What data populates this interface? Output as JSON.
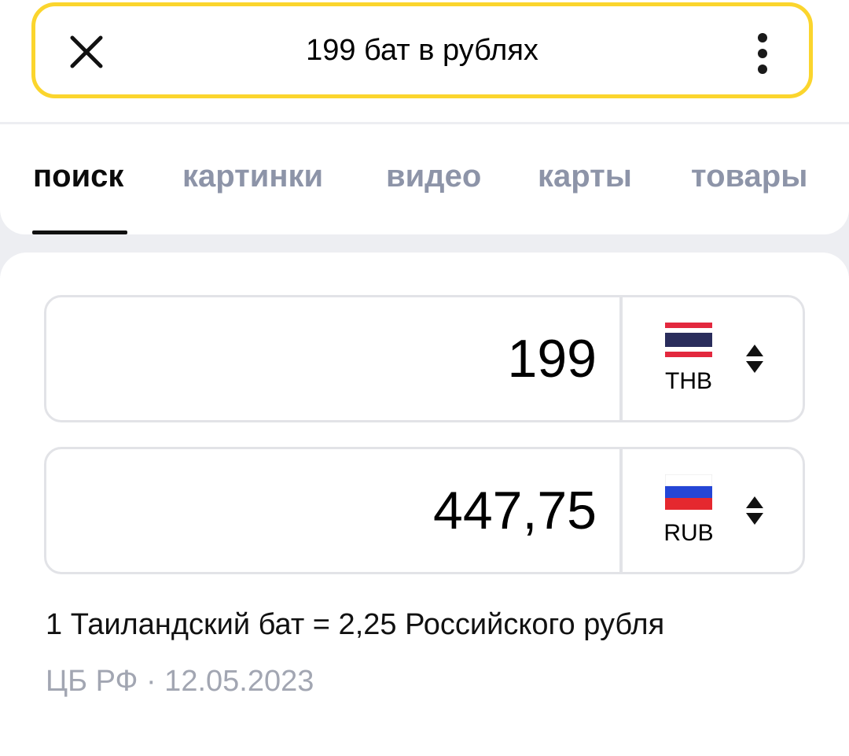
{
  "search": {
    "query": "199 бат в рублях",
    "close_icon": "close-icon",
    "more_icon": "more-vertical-icon",
    "accent_color": "#fbd52d"
  },
  "tabs": [
    {
      "label": "поиск",
      "active": true
    },
    {
      "label": "картинки",
      "active": false
    },
    {
      "label": "видео",
      "active": false
    },
    {
      "label": "карты",
      "active": false
    },
    {
      "label": "товары",
      "active": false
    }
  ],
  "converter": {
    "from": {
      "amount": "199",
      "code": "THB",
      "flag_icon": "thailand-flag-icon"
    },
    "to": {
      "amount": "447,75",
      "code": "RUB",
      "flag_icon": "russia-flag-icon"
    },
    "swap_icon": "sort-updown-icon",
    "rate_text": "1 Таиландский бат = 2,25 Российского рубля",
    "source_text": "ЦБ РФ · 12.05.2023"
  }
}
